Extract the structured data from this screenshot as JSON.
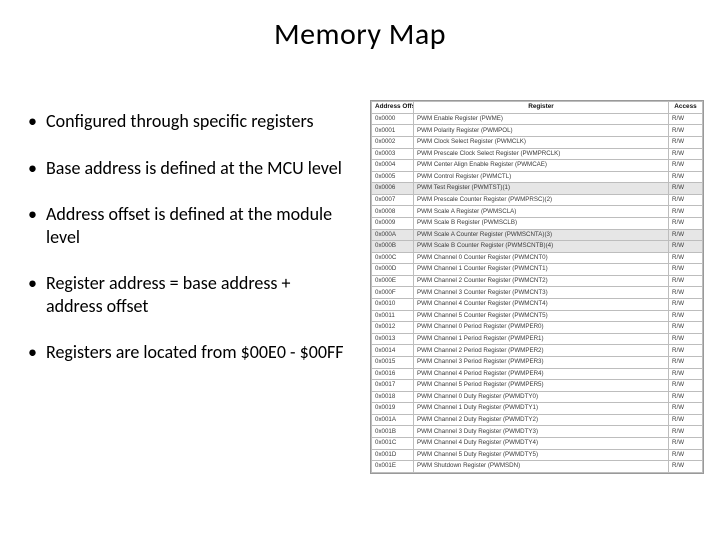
{
  "title": "Memory Map",
  "bullets": [
    "Configured through specific registers",
    "Base address is defined at the MCU level",
    "Address offset is defined at the module level",
    "Register address = base address + address offset",
    "Registers are located from $00E0 - $00FF"
  ],
  "table": {
    "headers": [
      "Address Offset",
      "Register",
      "Access"
    ],
    "rows": [
      {
        "offset": "0x0000",
        "register": "PWM Enable Register (PWME)",
        "access": "R/W",
        "shade": false
      },
      {
        "offset": "0x0001",
        "register": "PWM Polarity Register (PWMPOL)",
        "access": "R/W",
        "shade": false
      },
      {
        "offset": "0x0002",
        "register": "PWM Clock Select Register (PWMCLK)",
        "access": "R/W",
        "shade": false
      },
      {
        "offset": "0x0003",
        "register": "PWM Prescale Clock Select Register (PWMPRCLK)",
        "access": "R/W",
        "shade": false
      },
      {
        "offset": "0x0004",
        "register": "PWM Center Align Enable Register (PWMCAE)",
        "access": "R/W",
        "shade": false
      },
      {
        "offset": "0x0005",
        "register": "PWM Control Register (PWMCTL)",
        "access": "R/W",
        "shade": false
      },
      {
        "offset": "0x0006",
        "register": "PWM Test Register (PWMTST)(1)",
        "access": "R/W",
        "shade": true
      },
      {
        "offset": "0x0007",
        "register": "PWM Prescale Counter Register (PWMPRSC)(2)",
        "access": "R/W",
        "shade": false
      },
      {
        "offset": "0x0008",
        "register": "PWM Scale A Register (PWMSCLA)",
        "access": "R/W",
        "shade": false
      },
      {
        "offset": "0x0009",
        "register": "PWM Scale B Register (PWMSCLB)",
        "access": "R/W",
        "shade": false
      },
      {
        "offset": "0x000A",
        "register": "PWM Scale A Counter Register (PWMSCNTA)(3)",
        "access": "R/W",
        "shade": true
      },
      {
        "offset": "0x000B",
        "register": "PWM Scale B Counter Register (PWMSCNTB)(4)",
        "access": "R/W",
        "shade": true
      },
      {
        "offset": "0x000C",
        "register": "PWM Channel 0 Counter Register (PWMCNT0)",
        "access": "R/W",
        "shade": false
      },
      {
        "offset": "0x000D",
        "register": "PWM Channel 1 Counter Register (PWMCNT1)",
        "access": "R/W",
        "shade": false
      },
      {
        "offset": "0x000E",
        "register": "PWM Channel 2 Counter Register (PWMCNT2)",
        "access": "R/W",
        "shade": false
      },
      {
        "offset": "0x000F",
        "register": "PWM Channel 3 Counter Register (PWMCNT3)",
        "access": "R/W",
        "shade": false
      },
      {
        "offset": "0x0010",
        "register": "PWM Channel 4 Counter Register (PWMCNT4)",
        "access": "R/W",
        "shade": false
      },
      {
        "offset": "0x0011",
        "register": "PWM Channel 5 Counter Register (PWMCNT5)",
        "access": "R/W",
        "shade": false
      },
      {
        "offset": "0x0012",
        "register": "PWM Channel 0 Period Register (PWMPER0)",
        "access": "R/W",
        "shade": false
      },
      {
        "offset": "0x0013",
        "register": "PWM Channel 1 Period Register (PWMPER1)",
        "access": "R/W",
        "shade": false
      },
      {
        "offset": "0x0014",
        "register": "PWM Channel 2 Period Register (PWMPER2)",
        "access": "R/W",
        "shade": false
      },
      {
        "offset": "0x0015",
        "register": "PWM Channel 3 Period Register (PWMPER3)",
        "access": "R/W",
        "shade": false
      },
      {
        "offset": "0x0016",
        "register": "PWM Channel 4 Period Register (PWMPER4)",
        "access": "R/W",
        "shade": false
      },
      {
        "offset": "0x0017",
        "register": "PWM Channel 5 Period Register (PWMPER5)",
        "access": "R/W",
        "shade": false
      },
      {
        "offset": "0x0018",
        "register": "PWM Channel 0 Duty Register (PWMDTY0)",
        "access": "R/W",
        "shade": false
      },
      {
        "offset": "0x0019",
        "register": "PWM Channel 1 Duty Register (PWMDTY1)",
        "access": "R/W",
        "shade": false
      },
      {
        "offset": "0x001A",
        "register": "PWM Channel 2 Duty Register (PWMDTY2)",
        "access": "R/W",
        "shade": false
      },
      {
        "offset": "0x001B",
        "register": "PWM Channel 3 Duty Register (PWMDTY3)",
        "access": "R/W",
        "shade": false
      },
      {
        "offset": "0x001C",
        "register": "PWM Channel 4 Duty Register (PWMDTY4)",
        "access": "R/W",
        "shade": false
      },
      {
        "offset": "0x001D",
        "register": "PWM Channel 5 Duty Register (PWMDTY5)",
        "access": "R/W",
        "shade": false
      },
      {
        "offset": "0x001E",
        "register": "PWM Shutdown Register (PWMSDN)",
        "access": "R/W",
        "shade": false
      }
    ]
  }
}
